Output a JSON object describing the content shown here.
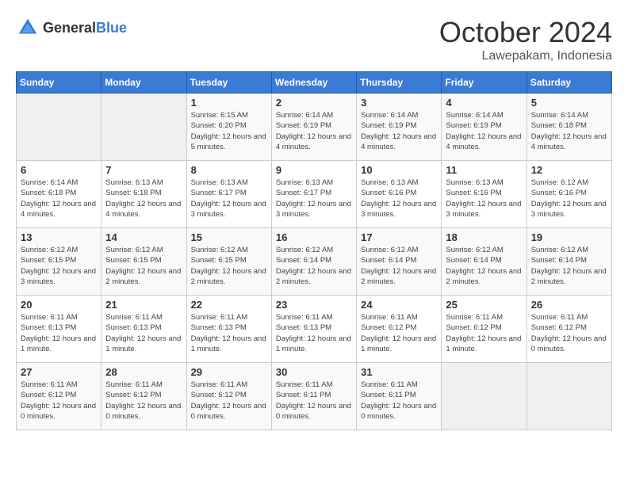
{
  "header": {
    "logo_general": "General",
    "logo_blue": "Blue",
    "month": "October 2024",
    "location": "Lawepakam, Indonesia"
  },
  "weekdays": [
    "Sunday",
    "Monday",
    "Tuesday",
    "Wednesday",
    "Thursday",
    "Friday",
    "Saturday"
  ],
  "weeks": [
    [
      {
        "day": "",
        "info": ""
      },
      {
        "day": "",
        "info": ""
      },
      {
        "day": "1",
        "info": "Sunrise: 6:15 AM\nSunset: 6:20 PM\nDaylight: 12 hours and 5 minutes."
      },
      {
        "day": "2",
        "info": "Sunrise: 6:14 AM\nSunset: 6:19 PM\nDaylight: 12 hours and 4 minutes."
      },
      {
        "day": "3",
        "info": "Sunrise: 6:14 AM\nSunset: 6:19 PM\nDaylight: 12 hours and 4 minutes."
      },
      {
        "day": "4",
        "info": "Sunrise: 6:14 AM\nSunset: 6:19 PM\nDaylight: 12 hours and 4 minutes."
      },
      {
        "day": "5",
        "info": "Sunrise: 6:14 AM\nSunset: 6:18 PM\nDaylight: 12 hours and 4 minutes."
      }
    ],
    [
      {
        "day": "6",
        "info": "Sunrise: 6:14 AM\nSunset: 6:18 PM\nDaylight: 12 hours and 4 minutes."
      },
      {
        "day": "7",
        "info": "Sunrise: 6:13 AM\nSunset: 6:18 PM\nDaylight: 12 hours and 4 minutes."
      },
      {
        "day": "8",
        "info": "Sunrise: 6:13 AM\nSunset: 6:17 PM\nDaylight: 12 hours and 3 minutes."
      },
      {
        "day": "9",
        "info": "Sunrise: 6:13 AM\nSunset: 6:17 PM\nDaylight: 12 hours and 3 minutes."
      },
      {
        "day": "10",
        "info": "Sunrise: 6:13 AM\nSunset: 6:16 PM\nDaylight: 12 hours and 3 minutes."
      },
      {
        "day": "11",
        "info": "Sunrise: 6:13 AM\nSunset: 6:16 PM\nDaylight: 12 hours and 3 minutes."
      },
      {
        "day": "12",
        "info": "Sunrise: 6:12 AM\nSunset: 6:16 PM\nDaylight: 12 hours and 3 minutes."
      }
    ],
    [
      {
        "day": "13",
        "info": "Sunrise: 6:12 AM\nSunset: 6:15 PM\nDaylight: 12 hours and 3 minutes."
      },
      {
        "day": "14",
        "info": "Sunrise: 6:12 AM\nSunset: 6:15 PM\nDaylight: 12 hours and 2 minutes."
      },
      {
        "day": "15",
        "info": "Sunrise: 6:12 AM\nSunset: 6:15 PM\nDaylight: 12 hours and 2 minutes."
      },
      {
        "day": "16",
        "info": "Sunrise: 6:12 AM\nSunset: 6:14 PM\nDaylight: 12 hours and 2 minutes."
      },
      {
        "day": "17",
        "info": "Sunrise: 6:12 AM\nSunset: 6:14 PM\nDaylight: 12 hours and 2 minutes."
      },
      {
        "day": "18",
        "info": "Sunrise: 6:12 AM\nSunset: 6:14 PM\nDaylight: 12 hours and 2 minutes."
      },
      {
        "day": "19",
        "info": "Sunrise: 6:12 AM\nSunset: 6:14 PM\nDaylight: 12 hours and 2 minutes."
      }
    ],
    [
      {
        "day": "20",
        "info": "Sunrise: 6:11 AM\nSunset: 6:13 PM\nDaylight: 12 hours and 1 minute."
      },
      {
        "day": "21",
        "info": "Sunrise: 6:11 AM\nSunset: 6:13 PM\nDaylight: 12 hours and 1 minute."
      },
      {
        "day": "22",
        "info": "Sunrise: 6:11 AM\nSunset: 6:13 PM\nDaylight: 12 hours and 1 minute."
      },
      {
        "day": "23",
        "info": "Sunrise: 6:11 AM\nSunset: 6:13 PM\nDaylight: 12 hours and 1 minute."
      },
      {
        "day": "24",
        "info": "Sunrise: 6:11 AM\nSunset: 6:12 PM\nDaylight: 12 hours and 1 minute."
      },
      {
        "day": "25",
        "info": "Sunrise: 6:11 AM\nSunset: 6:12 PM\nDaylight: 12 hours and 1 minute."
      },
      {
        "day": "26",
        "info": "Sunrise: 6:11 AM\nSunset: 6:12 PM\nDaylight: 12 hours and 0 minutes."
      }
    ],
    [
      {
        "day": "27",
        "info": "Sunrise: 6:11 AM\nSunset: 6:12 PM\nDaylight: 12 hours and 0 minutes."
      },
      {
        "day": "28",
        "info": "Sunrise: 6:11 AM\nSunset: 6:12 PM\nDaylight: 12 hours and 0 minutes."
      },
      {
        "day": "29",
        "info": "Sunrise: 6:11 AM\nSunset: 6:12 PM\nDaylight: 12 hours and 0 minutes."
      },
      {
        "day": "30",
        "info": "Sunrise: 6:11 AM\nSunset: 6:11 PM\nDaylight: 12 hours and 0 minutes."
      },
      {
        "day": "31",
        "info": "Sunrise: 6:11 AM\nSunset: 6:11 PM\nDaylight: 12 hours and 0 minutes."
      },
      {
        "day": "",
        "info": ""
      },
      {
        "day": "",
        "info": ""
      }
    ]
  ]
}
